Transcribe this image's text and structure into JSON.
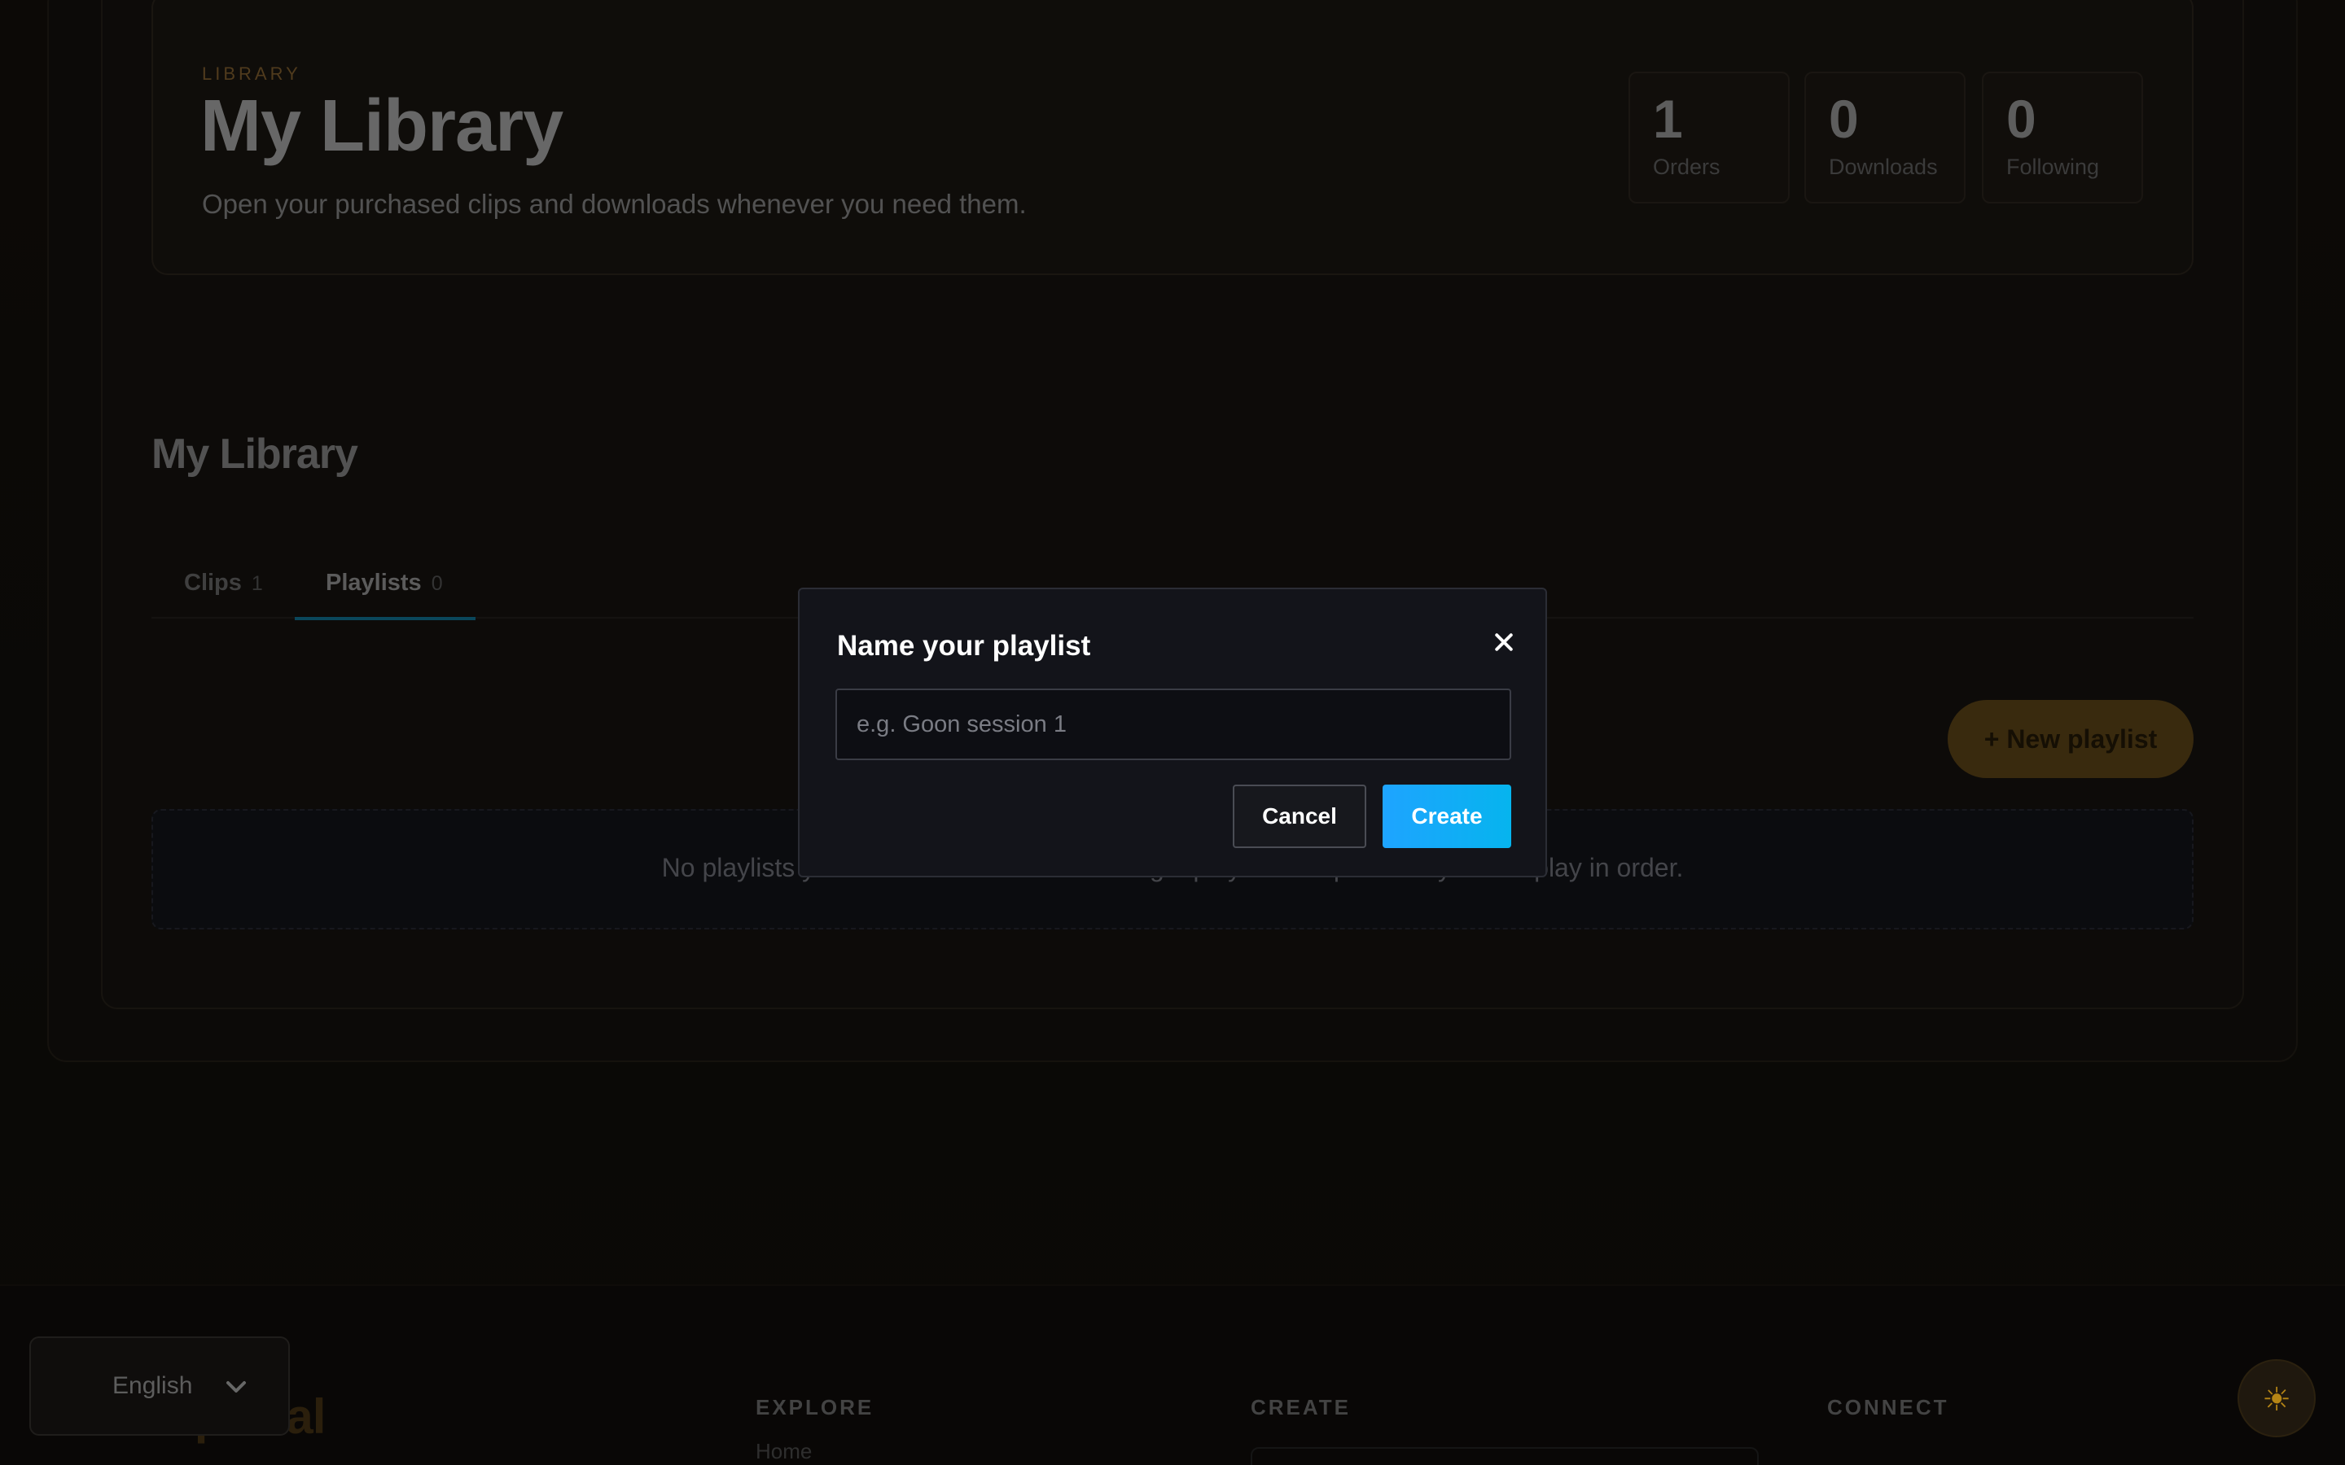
{
  "hero": {
    "eyebrow": "LIBRARY",
    "title": "My Library",
    "subtitle": "Open your purchased clips and downloads whenever you need them.",
    "stats": [
      {
        "value": "1",
        "label": "Orders"
      },
      {
        "value": "0",
        "label": "Downloads"
      },
      {
        "value": "0",
        "label": "Following"
      }
    ]
  },
  "section": {
    "title": "My Library",
    "tabs": [
      {
        "label": "Clips",
        "count": "1"
      },
      {
        "label": "Playlists",
        "count": "0"
      }
    ],
    "active_tab": "Playlists",
    "new_playlist_label": "+ New playlist",
    "empty_text": "No playlists yet. Create one to start building a playlist of clips — they'll auto-play in order."
  },
  "modal": {
    "title": "Name your playlist",
    "input_placeholder": "e.g. Goon session 1",
    "input_value": "",
    "cancel_label": "Cancel",
    "create_label": "Create",
    "close_icon": "close-icon"
  },
  "footer": {
    "brand": "Scatportal",
    "columns": [
      "EXPLORE",
      "CREATE",
      "CONNECT"
    ],
    "explore_first_link": "Home",
    "language": "English",
    "theme_icon": "sun-icon"
  },
  "colors": {
    "accent_blue": "#0ea5e9",
    "accent_gold": "#4c3813",
    "modal_bg": "#13141a"
  }
}
